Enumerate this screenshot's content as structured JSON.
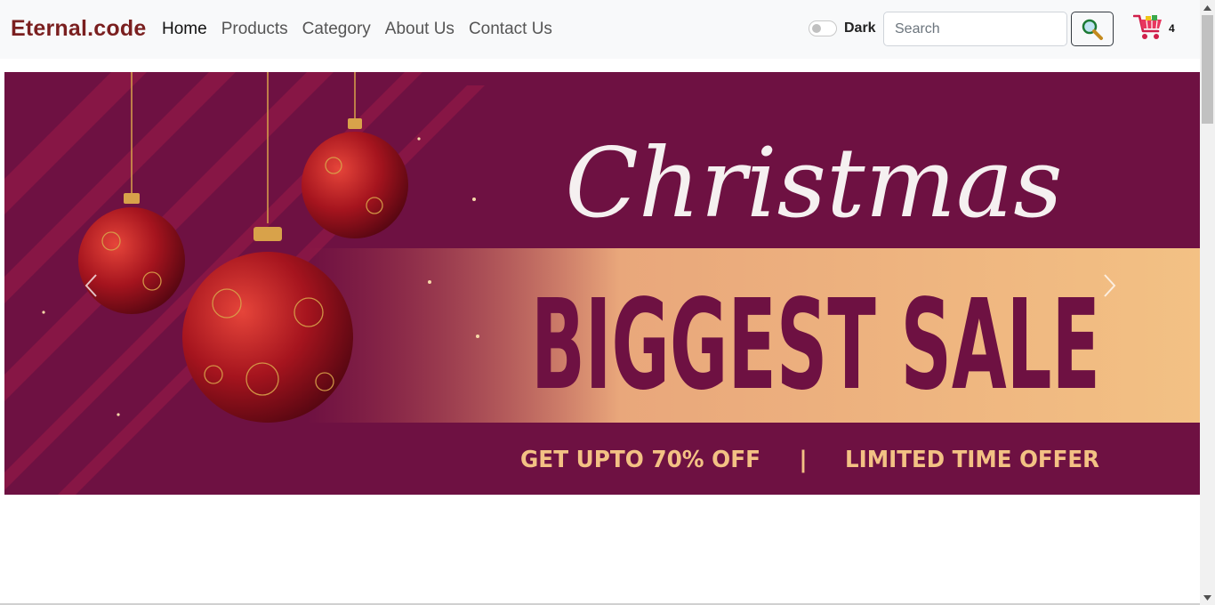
{
  "navbar": {
    "brand": "Eternal.code",
    "links": [
      "Home",
      "Products",
      "Category",
      "About Us",
      "Contact Us"
    ],
    "active_link": "Home",
    "dark_toggle_label": "Dark",
    "search_placeholder": "Search",
    "cart_count": "4",
    "icons": {
      "search": "magnifier-icon",
      "cart": "shopping-cart-icon"
    }
  },
  "banner": {
    "heading": "Christmas",
    "headline": "BIGGEST SALE",
    "offer_left": "GET UPTO 70% OFF",
    "separator": "|",
    "offer_right": "LIMITED TIME OFFER",
    "icons": {
      "prev": "chevron-left-icon",
      "next": "chevron-right-icon"
    }
  },
  "colors": {
    "brand": "#7a1f1f",
    "banner_background": "#6e1142",
    "banner_stripe": "#f3c184",
    "ornament": "#b3202a",
    "headline_text": "#6e1142"
  }
}
